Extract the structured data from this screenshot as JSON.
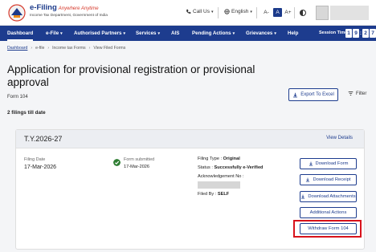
{
  "header": {
    "logo_title": "e-Filing",
    "logo_tagline": "Anywhere Anytime",
    "logo_subtitle": "Income Tax Department, Government of India",
    "call_us": "Call Us",
    "language": "English",
    "font_small": "A-",
    "font_normal": "A",
    "font_large": "A+"
  },
  "nav": {
    "items": [
      "Dashboard",
      "e-File",
      "Authorised Partners",
      "Services",
      "AIS",
      "Pending Actions",
      "Grievances",
      "Help"
    ],
    "session_label": "Session Time",
    "session_digits": [
      "1",
      "9",
      ":",
      "2",
      "7"
    ]
  },
  "breadcrumb": [
    "Dashboard",
    "e-file",
    "Income tax Forms",
    "View Filed Forms"
  ],
  "page": {
    "title": "Application for provisional registration or provisional approval",
    "form_code": "Form 104",
    "filings_count": "2 filings till date",
    "export_label": "Export To Excel",
    "filter_label": "Filter"
  },
  "card": {
    "year": "T.Y.2026-27",
    "view_details": "View Details",
    "filing_date_label": "Filing Date",
    "filing_date": "17-Mar-2026",
    "status_label": "Form submitted",
    "status_date": "17-Mar-2026",
    "filing_type_label": "Filing Type :",
    "filing_type": "Original",
    "status_line_label": "Status :",
    "status_value": "Successfully e-Verified",
    "ack_label": "Acknowledgement No :",
    "filed_by_label": "Filed By :",
    "filed_by": "SELF",
    "actions": [
      "Download Form",
      "Download Receipt",
      "Download Attachments",
      "Additional Actions",
      "Withdraw Form 104"
    ]
  },
  "colors": {
    "brand_blue": "#1d3c8e",
    "highlight_red": "#d8121b",
    "success_green": "#2e7d32"
  }
}
